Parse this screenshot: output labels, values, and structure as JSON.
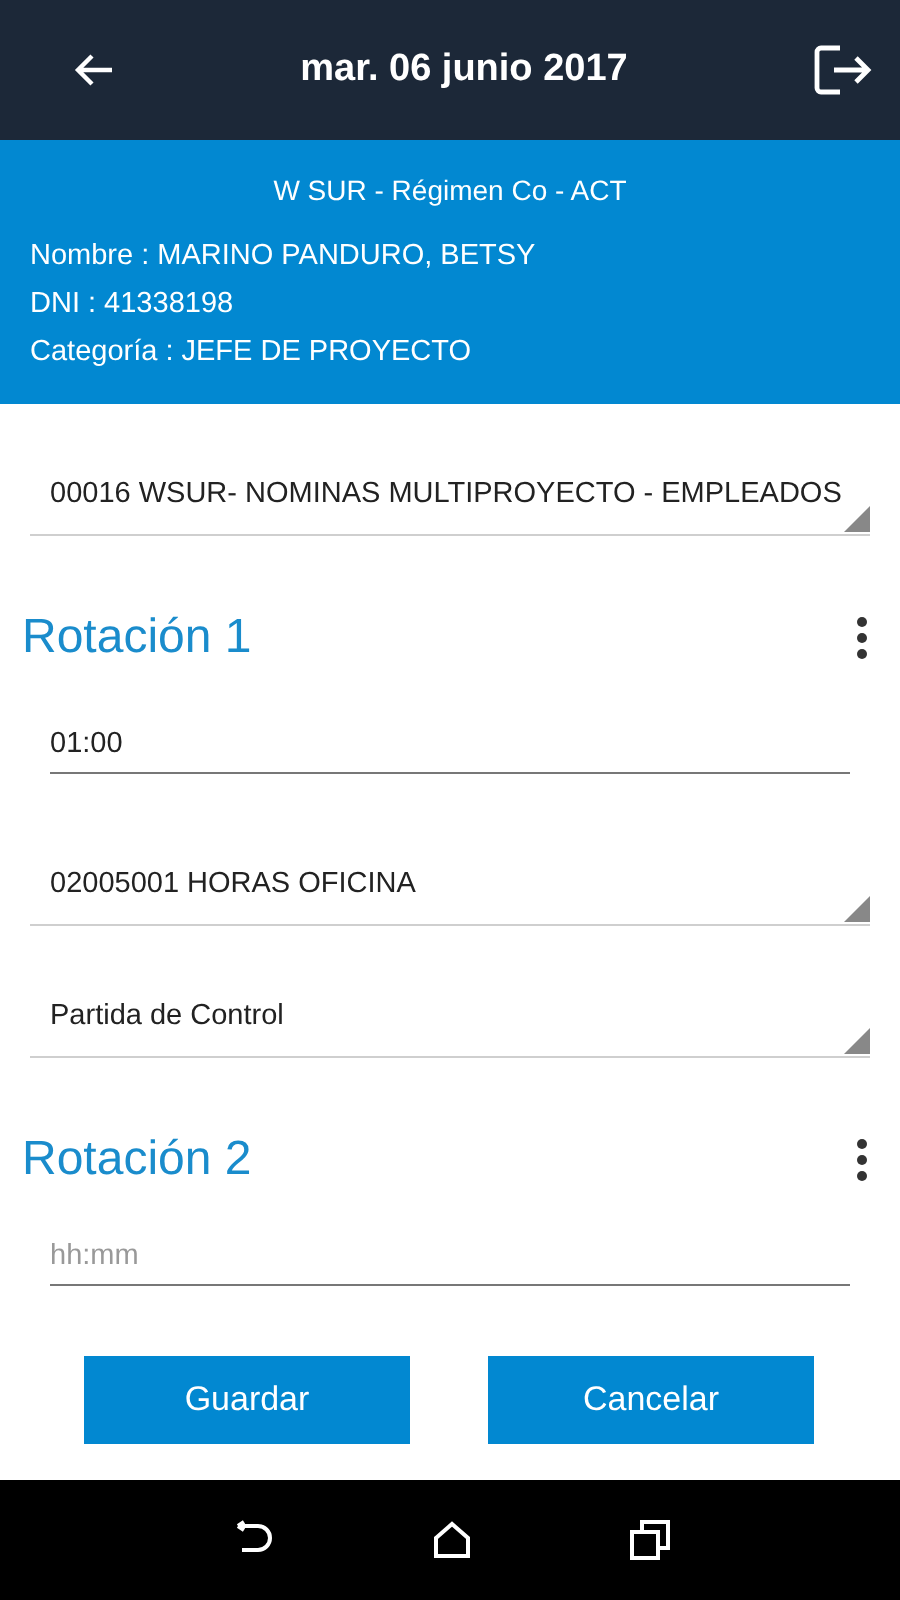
{
  "header": {
    "title": "mar. 06 junio 2017"
  },
  "info": {
    "title": "W SUR - Régimen Co - ACT",
    "lines": [
      "Nombre : MARINO PANDURO, BETSY",
      "DNI : 41338198",
      "Categoría : JEFE DE PROYECTO"
    ]
  },
  "project": {
    "value": "00016 WSUR- NOMINAS MULTIPROYECTO - EMPLEADOS"
  },
  "rotations": [
    {
      "title": "Rotación 1",
      "fields": [
        {
          "kind": "time",
          "value": "01:00"
        },
        {
          "kind": "select",
          "value": "02005001 HORAS OFICINA"
        },
        {
          "kind": "select",
          "value": "Partida de Control"
        }
      ]
    },
    {
      "title": "Rotación 2",
      "fields": [
        {
          "kind": "time",
          "placeholder": "hh:mm"
        }
      ]
    }
  ],
  "buttons": [
    "Guardar",
    "Cancelar"
  ]
}
